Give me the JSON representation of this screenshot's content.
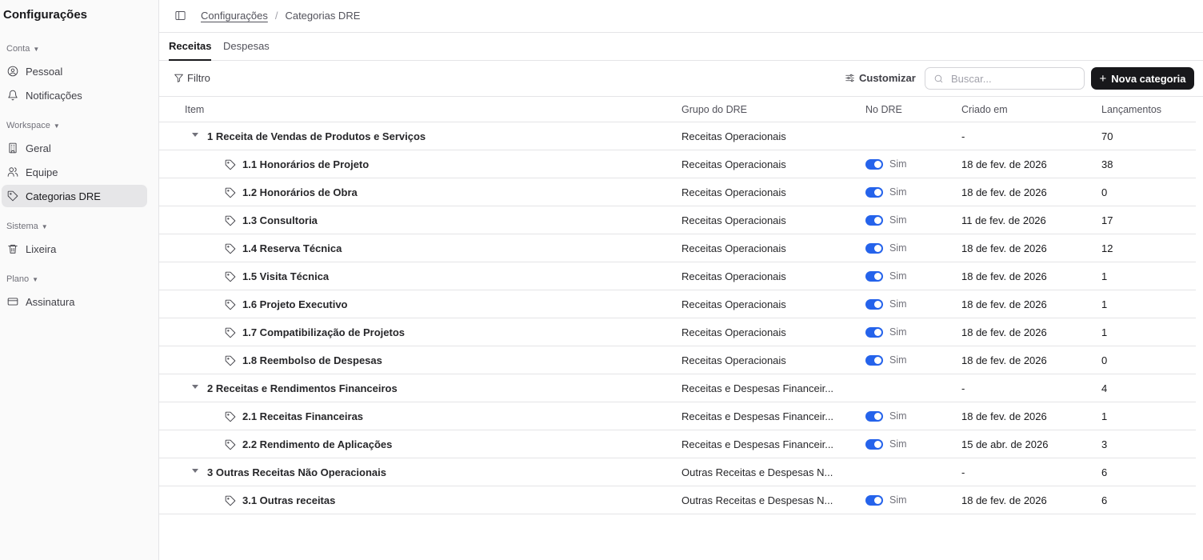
{
  "sidebar": {
    "title": "Configurações",
    "groups": [
      {
        "label": "Conta",
        "items": [
          {
            "label": "Pessoal",
            "icon": "user-circle-icon"
          },
          {
            "label": "Notificações",
            "icon": "bell-icon"
          }
        ]
      },
      {
        "label": "Workspace",
        "items": [
          {
            "label": "Geral",
            "icon": "building-icon"
          },
          {
            "label": "Equipe",
            "icon": "users-icon"
          },
          {
            "label": "Categorias DRE",
            "icon": "tag-icon",
            "active": true
          }
        ]
      },
      {
        "label": "Sistema",
        "items": [
          {
            "label": "Lixeira",
            "icon": "trash-icon"
          }
        ]
      },
      {
        "label": "Plano",
        "items": [
          {
            "label": "Assinatura",
            "icon": "credit-card-icon"
          }
        ]
      }
    ]
  },
  "header": {
    "breadcrumb": [
      "Configurações",
      "/",
      "Categorias DRE"
    ]
  },
  "tabs": [
    {
      "label": "Receitas",
      "active": true
    },
    {
      "label": "Despesas",
      "active": false
    }
  ],
  "toolbar": {
    "filter_label": "Filtro",
    "customize_label": "Customizar",
    "search_placeholder": "Buscar...",
    "new_label": "Nova categoria"
  },
  "table": {
    "columns": [
      "Item",
      "Grupo do DRE",
      "No DRE",
      "Criado em",
      "Lançamentos"
    ],
    "rows": [
      {
        "level": 0,
        "name": "1 Receita de Vendas de Produtos e Serviços",
        "group": "Receitas Operacionais",
        "in_dre": "",
        "created": "-",
        "count": "70"
      },
      {
        "level": 1,
        "name": "1.1 Honorários de Projeto",
        "group": "Receitas Operacionais",
        "in_dre": "Sim",
        "created": "18 de fev. de 2026",
        "count": "38"
      },
      {
        "level": 1,
        "name": "1.2 Honorários de Obra",
        "group": "Receitas Operacionais",
        "in_dre": "Sim",
        "created": "18 de fev. de 2026",
        "count": "0"
      },
      {
        "level": 1,
        "name": "1.3 Consultoria",
        "group": "Receitas Operacionais",
        "in_dre": "Sim",
        "created": "11 de fev. de 2026",
        "count": "17"
      },
      {
        "level": 1,
        "name": "1.4 Reserva Técnica",
        "group": "Receitas Operacionais",
        "in_dre": "Sim",
        "created": "18 de fev. de 2026",
        "count": "12"
      },
      {
        "level": 1,
        "name": "1.5 Visita Técnica",
        "group": "Receitas Operacionais",
        "in_dre": "Sim",
        "created": "18 de fev. de 2026",
        "count": "1"
      },
      {
        "level": 1,
        "name": "1.6 Projeto Executivo",
        "group": "Receitas Operacionais",
        "in_dre": "Sim",
        "created": "18 de fev. de 2026",
        "count": "1"
      },
      {
        "level": 1,
        "name": "1.7 Compatibilização de Projetos",
        "group": "Receitas Operacionais",
        "in_dre": "Sim",
        "created": "18 de fev. de 2026",
        "count": "1"
      },
      {
        "level": 1,
        "name": "1.8 Reembolso de Despesas",
        "group": "Receitas Operacionais",
        "in_dre": "Sim",
        "created": "18 de fev. de 2026",
        "count": "0"
      },
      {
        "level": 0,
        "name": "2 Receitas e Rendimentos Financeiros",
        "group": "Receitas e Despesas Financeir...",
        "in_dre": "",
        "created": "-",
        "count": "4"
      },
      {
        "level": 1,
        "name": "2.1 Receitas Financeiras",
        "group": "Receitas e Despesas Financeir...",
        "in_dre": "Sim",
        "created": "18 de fev. de 2026",
        "count": "1"
      },
      {
        "level": 1,
        "name": "2.2 Rendimento de Aplicações",
        "group": "Receitas e Despesas Financeir...",
        "in_dre": "Sim",
        "created": "15 de abr. de 2026",
        "count": "3"
      },
      {
        "level": 0,
        "name": "3 Outras Receitas Não Operacionais",
        "group": "Outras Receitas e Despesas N...",
        "in_dre": "",
        "created": "-",
        "count": "6"
      },
      {
        "level": 1,
        "name": "3.1 Outras receitas",
        "group": "Outras Receitas e Despesas N...",
        "in_dre": "Sim",
        "created": "18 de fev. de 2026",
        "count": "6"
      }
    ]
  },
  "colors": {
    "accent": "#2563eb",
    "primary_button": "#18181b",
    "sidebar_bg": "#fafafa",
    "active_item_bg": "#e6e6e8"
  }
}
